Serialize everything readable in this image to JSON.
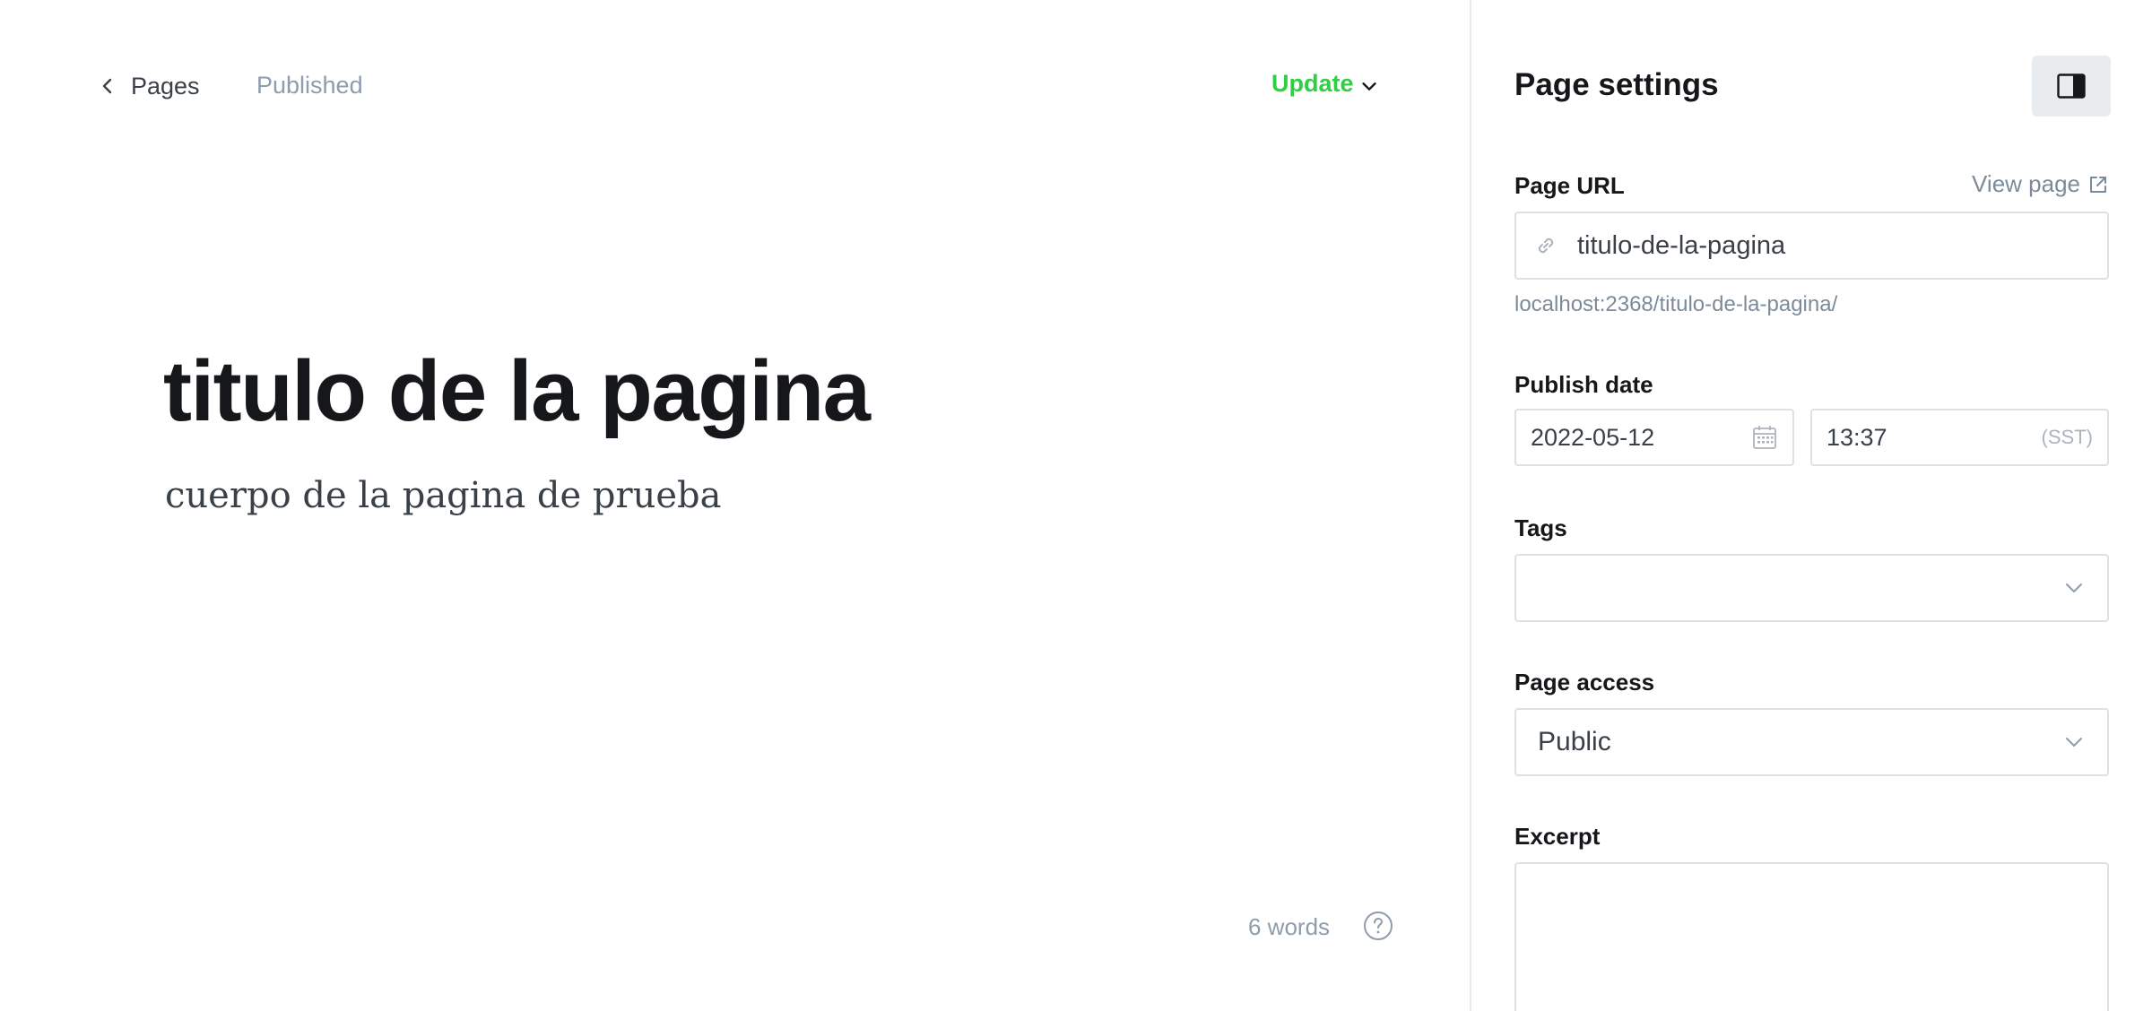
{
  "editor": {
    "back_label": "Pages",
    "status": "Published",
    "update_label": "Update",
    "title": "titulo de la pagina",
    "body": "cuerpo de la pagina de prueba",
    "word_count": "6 words"
  },
  "settings": {
    "title": "Page settings",
    "page_url": {
      "label": "Page URL",
      "view_page": "View page",
      "value": "titulo-de-la-pagina",
      "full_url": "localhost:2368/titulo-de-la-pagina/"
    },
    "publish_date": {
      "label": "Publish date",
      "date": "2022-05-12",
      "time": "13:37",
      "timezone": "(SST)"
    },
    "tags": {
      "label": "Tags",
      "value": ""
    },
    "page_access": {
      "label": "Page access",
      "value": "Public"
    },
    "excerpt": {
      "label": "Excerpt",
      "value": ""
    }
  },
  "colors": {
    "accent_green": "#30cf43",
    "muted_text": "#8e9cac",
    "border": "#dde1e5"
  },
  "icons": {
    "back": "chevron-left-icon",
    "update_caret": "chevron-down-icon",
    "help": "question-circle-icon",
    "panel_toggle": "sidebar-toggle-icon",
    "view_page": "external-link-icon",
    "url": "link-icon",
    "date": "calendar-icon",
    "select_caret": "chevron-down-icon"
  }
}
